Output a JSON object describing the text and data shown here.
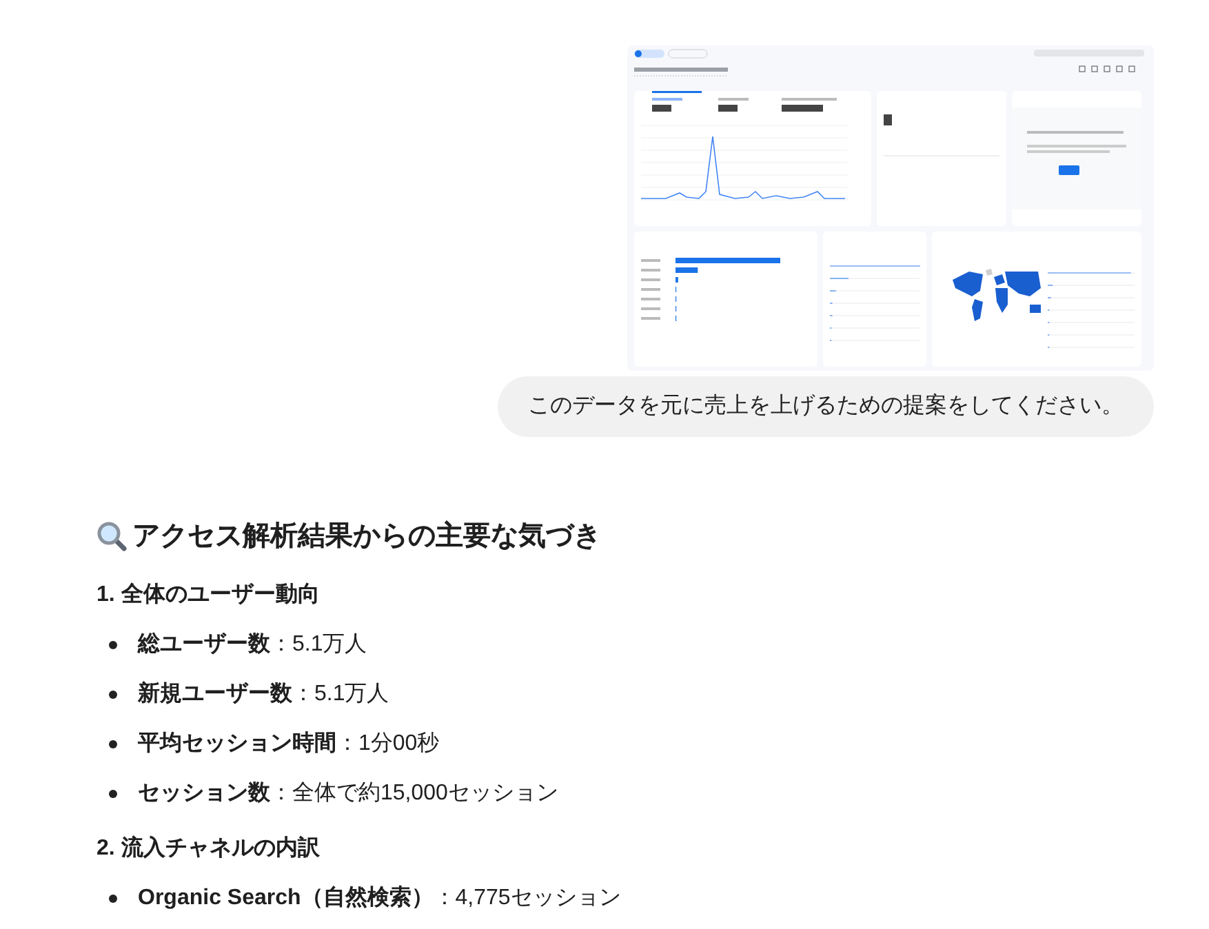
{
  "user_message": "このデータを元に売上を上げるための提案をしてください。",
  "heading": "アクセス解析結果からの主要な気づき",
  "sections": [
    {
      "title": "1. 全体のユーザー動向",
      "items": [
        "**総ユーザー数**：5.1万人",
        "**新規ユーザー数**：5.1万人",
        "**平均セッション時間**：1分00秒",
        "**セッション数**：全体で約15,000セッション"
      ]
    },
    {
      "title": "2. 流入チャネルの内訳",
      "items": [
        "**Organic Search（自然検索）**：4,775セッション"
      ]
    }
  ]
}
